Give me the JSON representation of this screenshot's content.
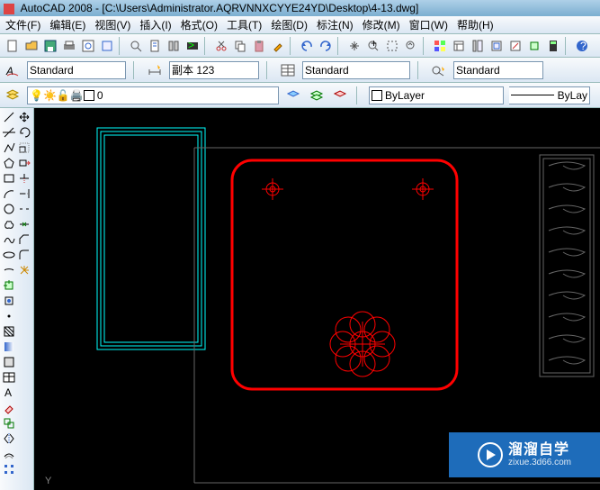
{
  "title": "AutoCAD 2008 - [C:\\Users\\Administrator.AQRVNNXCYYE24YD\\Desktop\\4-13.dwg]",
  "menu": [
    "文件(F)",
    "编辑(E)",
    "视图(V)",
    "插入(I)",
    "格式(O)",
    "工具(T)",
    "绘图(D)",
    "标注(N)",
    "修改(M)",
    "窗口(W)",
    "帮助(H)"
  ],
  "style": {
    "text": "Standard",
    "dim": "副本 123",
    "table": "Standard",
    "ml": "Standard"
  },
  "layer": {
    "current": "0",
    "prop": "ByLayer",
    "lw": "ByLay"
  },
  "axis": {
    "y": "Y"
  },
  "watermark": {
    "brand": "溜溜自学",
    "url": "zixue.3d66.com"
  }
}
